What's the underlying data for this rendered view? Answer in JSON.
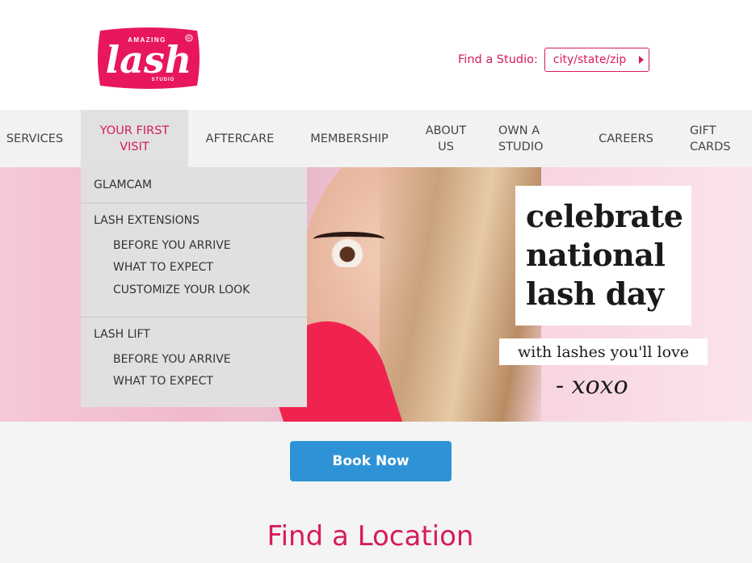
{
  "header": {
    "logo": {
      "top_text": "AMAZING",
      "main_text": "lash",
      "bottom_text": "STUDIO",
      "mark": "®",
      "bg_color": "#e8175d"
    },
    "finder": {
      "label": "Find a Studio:",
      "input_value": "city/state/zip",
      "accent": "#d81b5a"
    }
  },
  "nav": {
    "items": [
      {
        "label": "SERVICES"
      },
      {
        "label": "YOUR FIRST VISIT",
        "active": true
      },
      {
        "label": "AFTERCARE"
      },
      {
        "label": "MEMBERSHIP"
      },
      {
        "label": "ABOUT US"
      },
      {
        "label": "OWN A STUDIO"
      },
      {
        "label": "CAREERS"
      },
      {
        "label": "GIFT CARDS"
      }
    ]
  },
  "dropdown": {
    "glamcam": "GLAMCAM",
    "lash_extensions": {
      "label": "LASH EXTENSIONS",
      "subitems": [
        "BEFORE YOU ARRIVE",
        "WHAT TO EXPECT",
        "CUSTOMIZE YOUR LOOK"
      ]
    },
    "lash_lift": {
      "label": "LASH LIFT",
      "subitems": [
        "BEFORE YOU ARRIVE",
        "WHAT TO EXPECT"
      ]
    }
  },
  "hero": {
    "title_lines": [
      "celebrate",
      "national",
      "lash day"
    ],
    "subtitle": "with lashes you'll love",
    "signature": "- xoxo"
  },
  "cta": {
    "book_label": "Book Now",
    "color": "#2d93d6"
  },
  "find_location": {
    "title": "Find a Location"
  }
}
